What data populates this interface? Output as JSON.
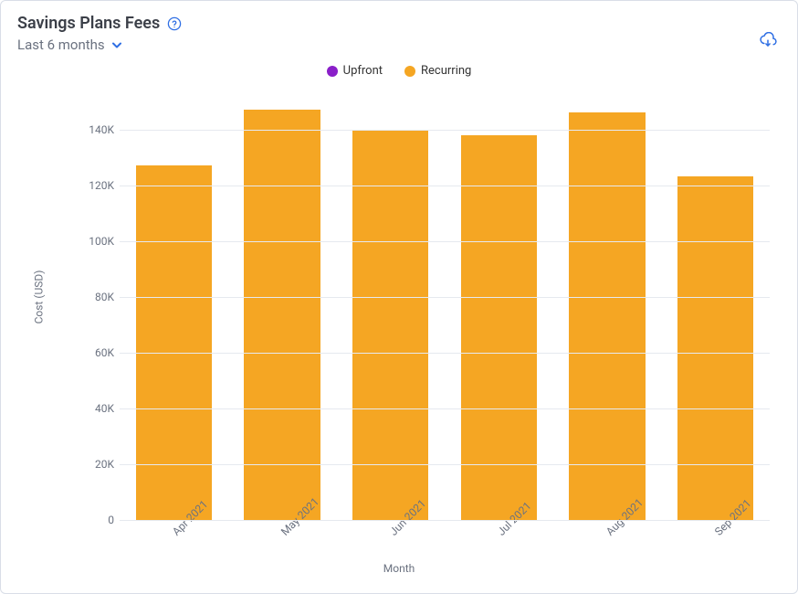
{
  "header": {
    "title": "Savings Plans Fees",
    "range": "Last 6 months"
  },
  "legend": {
    "upfront": "Upfront",
    "recurring": "Recurring"
  },
  "axes": {
    "ylabel": "Cost (USD)",
    "xlabel": "Month"
  },
  "colors": {
    "upfront": "#8a1fc9",
    "recurring": "#f5a623",
    "accent": "#2f6fe4"
  },
  "chart_data": {
    "type": "bar",
    "title": "Savings Plans Fees",
    "xlabel": "Month",
    "ylabel": "Cost (USD)",
    "ylim": [
      0,
      150000
    ],
    "yticks": [
      0,
      20000,
      40000,
      60000,
      80000,
      100000,
      120000,
      140000
    ],
    "ytick_labels": [
      "0",
      "20K",
      "40K",
      "60K",
      "80K",
      "100K",
      "120K",
      "140K"
    ],
    "categories": [
      "Apr 2021",
      "May 2021",
      "Jun 2021",
      "Jul 2021",
      "Aug 2021",
      "Sep 2021"
    ],
    "series": [
      {
        "name": "Upfront",
        "color": "#8a1fc9",
        "values": [
          0,
          0,
          0,
          0,
          0,
          0
        ]
      },
      {
        "name": "Recurring",
        "color": "#f5a623",
        "values": [
          127000,
          147000,
          140000,
          138000,
          146000,
          123000
        ]
      }
    ],
    "legend_position": "top",
    "grid": true
  }
}
